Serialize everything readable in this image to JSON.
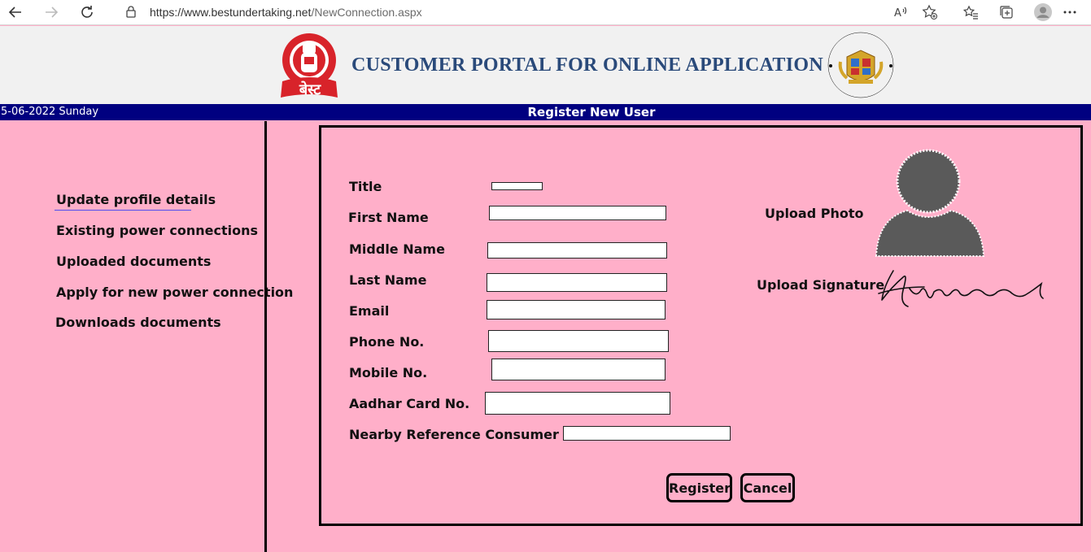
{
  "browser": {
    "url_host": "https://www.bestundertaking.net",
    "url_path": "/NewConnection.aspx"
  },
  "header": {
    "title": "CUSTOMER PORTAL FOR ONLINE APPLICATION",
    "best_logo_text": "बेस्ट",
    "mcgm_seal_text": "Municipal Corporation of Greater Mumbai"
  },
  "info_bar": {
    "date": "5-06-2022 Sunday",
    "page_title": "Register New User"
  },
  "sidebar": {
    "items": [
      {
        "label": "Update profile details"
      },
      {
        "label": "Existing power connections"
      },
      {
        "label": "Uploaded documents"
      },
      {
        "label": "Apply for new power connection"
      },
      {
        "label": "Downloads documents"
      }
    ]
  },
  "form": {
    "fields": [
      {
        "label": "Title",
        "value": ""
      },
      {
        "label": "First Name",
        "value": ""
      },
      {
        "label": "Middle Name",
        "value": ""
      },
      {
        "label": "Last Name",
        "value": ""
      },
      {
        "label": "Email",
        "value": ""
      },
      {
        "label": "Phone No.",
        "value": ""
      },
      {
        "label": "Mobile No.",
        "value": ""
      },
      {
        "label": "Aadhar Card No.",
        "value": ""
      },
      {
        "label": "Nearby Reference Consumer No.",
        "value": ""
      }
    ],
    "upload_photo_label": "Upload Photo",
    "upload_signature_label": "Upload Signature",
    "register_label": "Register",
    "cancel_label": "Cancel"
  },
  "colors": {
    "page_background": "#ffafc9",
    "info_bar": "#000080",
    "title_text": "#2a4a7a",
    "logo_red": "#d8232a"
  }
}
